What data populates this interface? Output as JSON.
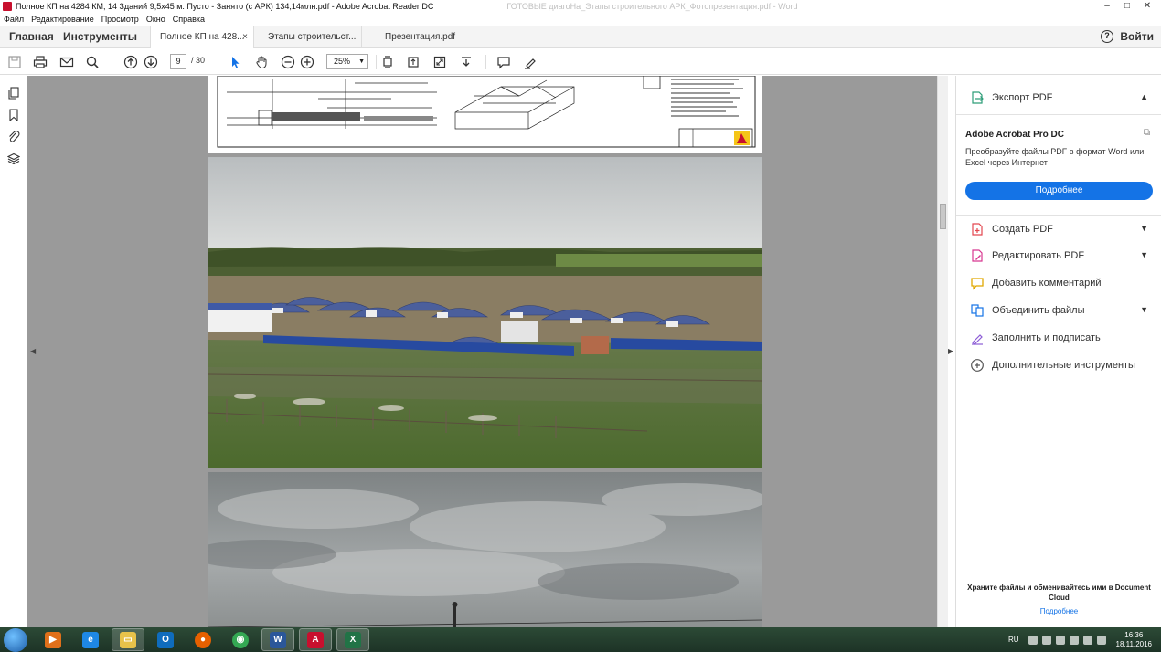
{
  "window": {
    "title": "Полное КП на 4284 КМ, 14 Зданий 9,5х45 м. Пусто - Занято (с АРК) 134,14млн.pdf - Adobe Acrobat Reader DC",
    "ghost_title": "ГОТОВЫЕ диагоНа_Этапы строительного АРК_Фотопрезентация.pdf - Word",
    "controls": [
      "–",
      "□",
      "✕"
    ]
  },
  "menu": [
    "Файл",
    "Редактирование",
    "Просмотр",
    "Окно",
    "Справка"
  ],
  "nav": {
    "home": "Главная",
    "tools": "Инструменты"
  },
  "tabs": [
    {
      "label": "Полное КП на 428...",
      "close": "×",
      "active": true
    },
    {
      "label": "Этапы строительст...",
      "active": false
    },
    {
      "label": "Презентация.pdf",
      "active": false
    }
  ],
  "header": {
    "help": "?",
    "login": "Войти"
  },
  "toolbar": {
    "page_current": "9",
    "page_total": "/ 30",
    "zoom": "25%"
  },
  "right_panel": {
    "export_pdf": "Экспорт PDF",
    "promo_title": "Adobe Acrobat Pro DC",
    "promo_text": "Преобразуйте файлы PDF в формат Word или Excel через Интернет",
    "promo_button": "Подробнее",
    "tools": [
      {
        "label": "Создать PDF",
        "icon": "create-pdf-icon",
        "color": "#e34850",
        "chevron": true
      },
      {
        "label": "Редактировать PDF",
        "icon": "edit-pdf-icon",
        "color": "#d83790",
        "chevron": true
      },
      {
        "label": "Добавить комментарий",
        "icon": "comment-icon",
        "color": "#f5c518",
        "chevron": false
      },
      {
        "label": "Объединить файлы",
        "icon": "combine-files-icon",
        "color": "#1473e6",
        "chevron": true
      },
      {
        "label": "Заполнить и подписать",
        "icon": "fill-sign-icon",
        "color": "#8c5cd6",
        "chevron": false
      },
      {
        "label": "Дополнительные инструменты",
        "icon": "more-tools-icon",
        "color": "#555555",
        "chevron": false
      }
    ],
    "cloud_text": "Храните файлы и обменивайтесь ими в Document Cloud",
    "cloud_link": "Подробнее"
  },
  "taskbar": {
    "apps": [
      {
        "name": "media-player",
        "color": "#e0701a",
        "glyph": "▶"
      },
      {
        "name": "internet-explorer",
        "color": "#1e88e5",
        "glyph": "e"
      },
      {
        "name": "file-explorer",
        "color": "#e8c24a",
        "glyph": "▭"
      },
      {
        "name": "outlook",
        "color": "#0f6cbd",
        "glyph": "O"
      },
      {
        "name": "firefox",
        "color": "#e66000",
        "glyph": "●"
      },
      {
        "name": "chrome",
        "color": "#34a853",
        "glyph": "◉"
      },
      {
        "name": "word",
        "color": "#2b579a",
        "glyph": "W"
      },
      {
        "name": "acrobat",
        "color": "#c8102e",
        "glyph": "A"
      },
      {
        "name": "excel",
        "color": "#217346",
        "glyph": "X"
      }
    ],
    "lang": "RU",
    "time": "16:36",
    "date": "18.11.2016"
  }
}
